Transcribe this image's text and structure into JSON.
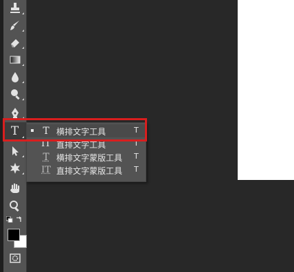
{
  "colors": {
    "panel_bg": "#535353",
    "workspace_bg": "#282828",
    "highlight": "#d91e1e",
    "foreground_swatch": "#000000",
    "background_swatch": "#ffffff"
  },
  "toolbar": {
    "tools": [
      {
        "name": "stamp-icon"
      },
      {
        "name": "history-brush-icon"
      },
      {
        "name": "eraser-icon"
      },
      {
        "name": "gradient-icon"
      },
      {
        "name": "blur-icon"
      },
      {
        "name": "dodge-icon"
      },
      {
        "name": "pen-icon"
      },
      {
        "name": "type-tool-icon",
        "glyph": "T"
      },
      {
        "name": "path-selection-icon"
      },
      {
        "name": "custom-shape-icon"
      },
      {
        "name": "hand-icon"
      },
      {
        "name": "zoom-icon"
      },
      {
        "name": "quick-mask-icon"
      }
    ]
  },
  "flyout": {
    "items": [
      {
        "glyph": "T",
        "label": "横排文字工具",
        "shortcut": "T",
        "selected": true
      },
      {
        "glyph": "IT",
        "label": "直排文字工具",
        "shortcut": "T",
        "selected": false
      },
      {
        "glyph": "T",
        "label": "横排文字蒙版工具",
        "shortcut": "T",
        "selected": false
      },
      {
        "glyph": "IT",
        "label": "直排文字蒙版工具",
        "shortcut": "T",
        "selected": false
      }
    ]
  }
}
